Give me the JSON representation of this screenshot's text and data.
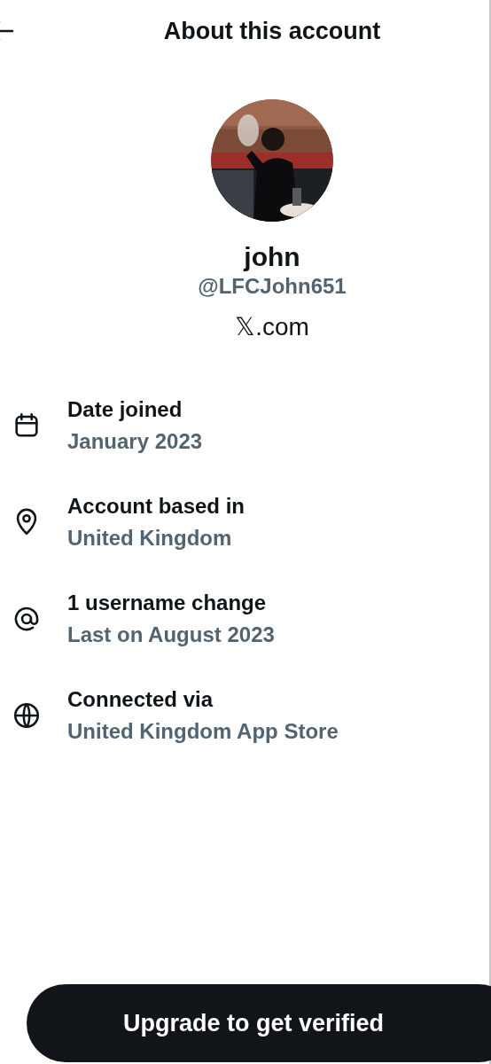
{
  "header": {
    "title": "About this account"
  },
  "profile": {
    "name": "john",
    "handle": "@LFCJohn651",
    "site": "𝕏.com"
  },
  "details": [
    {
      "kind": "calendar",
      "label": "Date joined",
      "value": "January 2023"
    },
    {
      "kind": "location",
      "label": "Account based in",
      "value": "United Kingdom"
    },
    {
      "kind": "at",
      "label": "1 username change",
      "value": "Last on August 2023"
    },
    {
      "kind": "globe",
      "label": "Connected via",
      "value": "United Kingdom App Store"
    }
  ],
  "action": {
    "label": "Upgrade to get verified"
  }
}
